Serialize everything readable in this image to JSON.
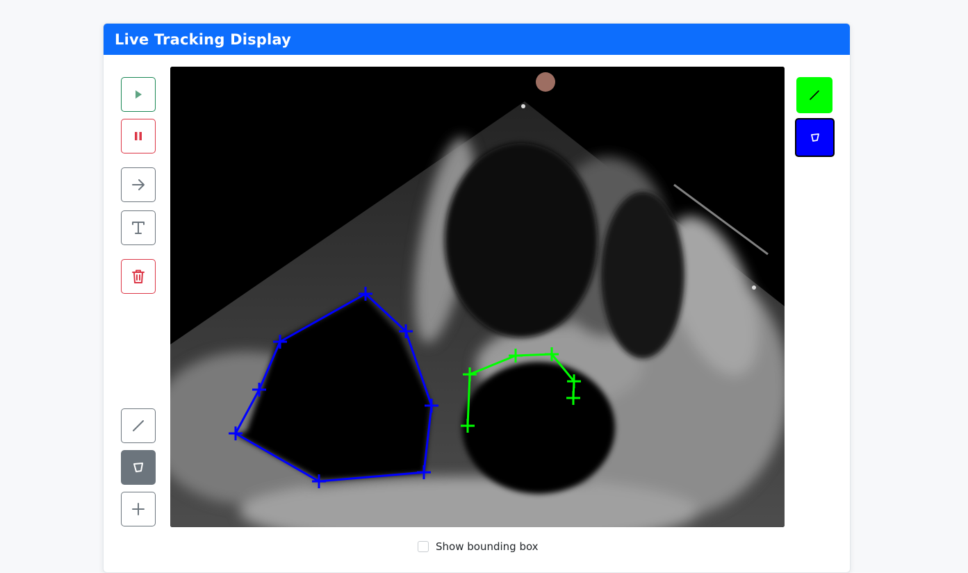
{
  "header": {
    "title": "Live Tracking Display"
  },
  "controls": {
    "bounding_box_label": "Show bounding box",
    "bounding_box_checked": false
  },
  "colors": {
    "header_bg": "#0d6efd",
    "line_color": "#00ff00",
    "polygon_color": "#0000ff",
    "success": "#198754",
    "danger": "#dc3545",
    "secondary": "#6c757d"
  },
  "toolbar_left": [
    {
      "name": "play",
      "icon": "play-icon"
    },
    {
      "name": "pause",
      "icon": "pause-icon"
    },
    {
      "name": "arrow",
      "icon": "arrow-right-icon"
    },
    {
      "name": "text",
      "icon": "text-icon"
    },
    {
      "name": "delete",
      "icon": "trash-icon"
    },
    {
      "name": "line-tool",
      "icon": "line-icon"
    },
    {
      "name": "polygon-tool",
      "icon": "polygon-icon",
      "active": true
    },
    {
      "name": "add-point",
      "icon": "plus-icon"
    }
  ],
  "toolbar_right": [
    {
      "name": "line-color",
      "icon": "line-icon",
      "color": "#00ff00"
    },
    {
      "name": "polygon-color",
      "icon": "polygon-icon",
      "color": "#0000ff",
      "selected": true
    }
  ],
  "annotations": {
    "blue_polygon_label": "polygon",
    "green_line_label": "line"
  }
}
